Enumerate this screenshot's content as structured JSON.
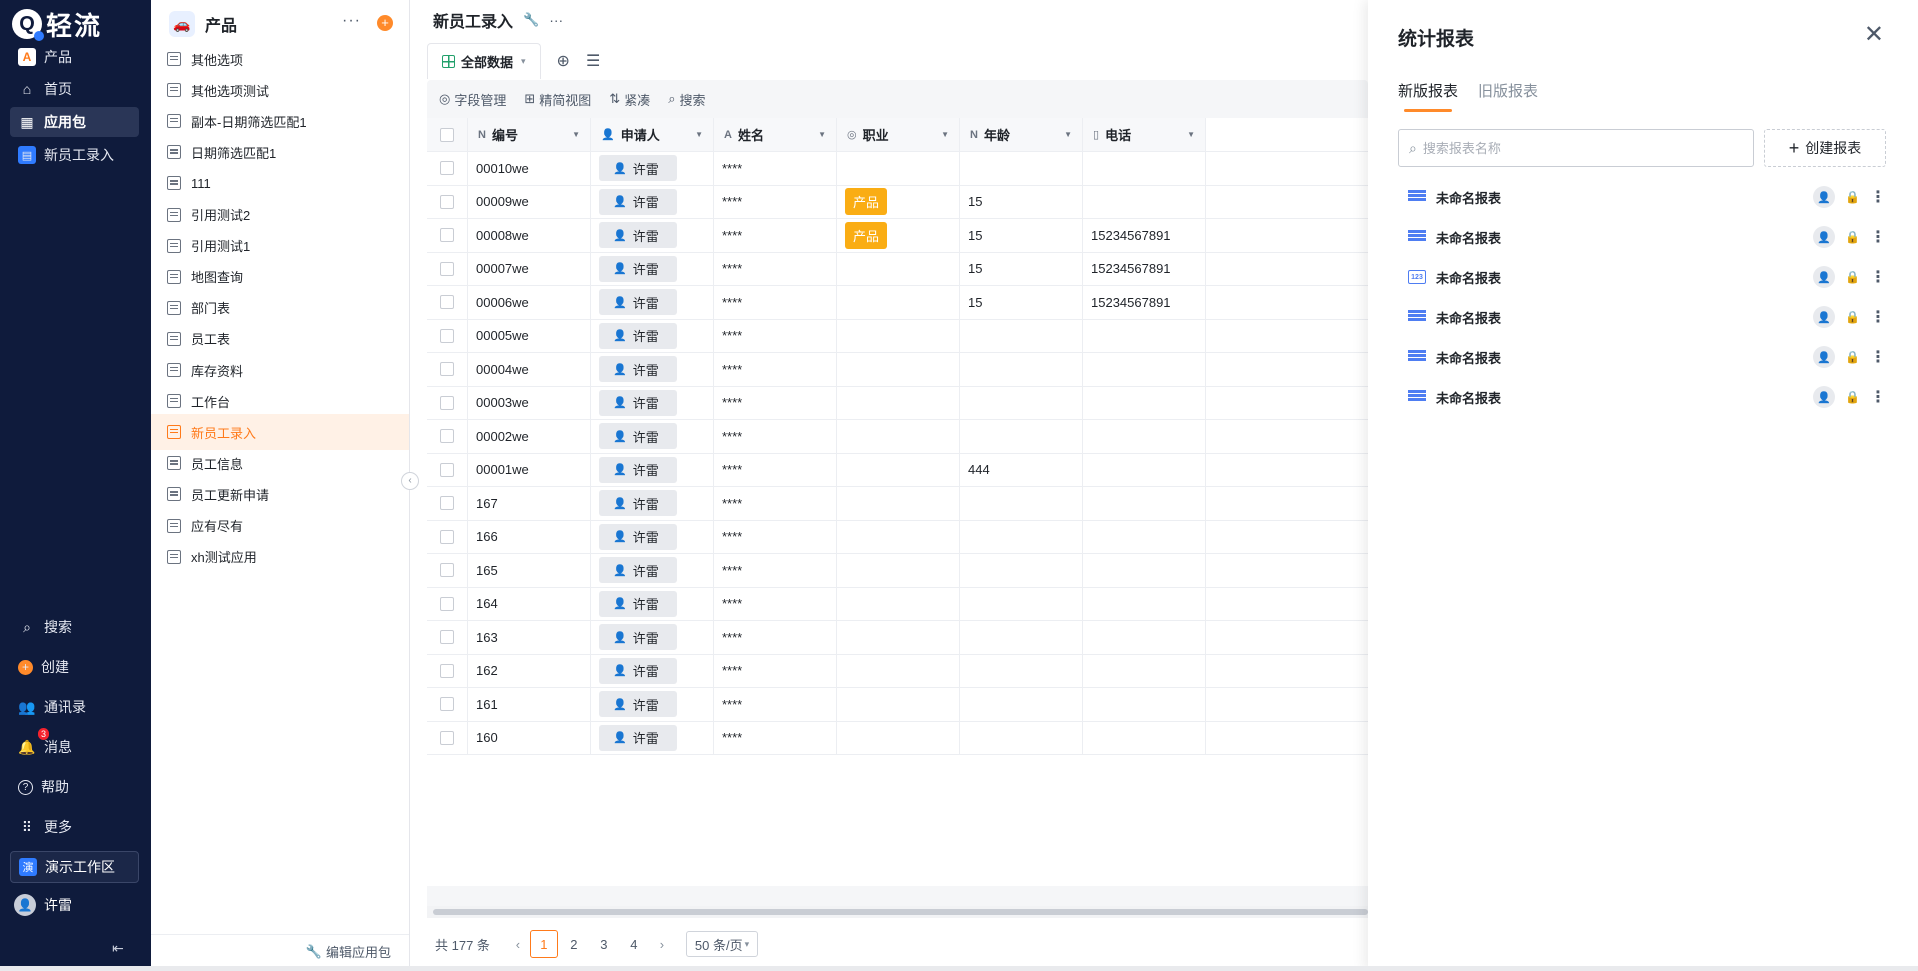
{
  "brand": {
    "name": "轻流",
    "q": "Q"
  },
  "sidebar": {
    "items": [
      {
        "label": "产品",
        "icon": "product-app-icon"
      },
      {
        "label": "首页",
        "icon": "home-icon"
      },
      {
        "label": "应用包",
        "icon": "apps-grid-icon",
        "active": true
      },
      {
        "label": "新员工录入",
        "icon": "form-app-icon"
      }
    ],
    "bottom": [
      {
        "label": "搜索",
        "icon": "search-icon"
      },
      {
        "label": "创建",
        "icon": "plus-circle-icon"
      },
      {
        "label": "通讯录",
        "icon": "contacts-icon"
      },
      {
        "label": "消息",
        "icon": "bell-icon",
        "badge": "3"
      },
      {
        "label": "帮助",
        "icon": "help-icon"
      },
      {
        "label": "更多",
        "icon": "more-grid-icon"
      }
    ],
    "workspace": {
      "label": "演示工作区",
      "glyph": "演"
    },
    "user": {
      "name": "许雷"
    }
  },
  "applist": {
    "title": "产品",
    "more": "···",
    "plus": "+",
    "items": [
      {
        "label": "其他选项"
      },
      {
        "label": "其他选项测试"
      },
      {
        "label": "副本-日期筛选匹配1"
      },
      {
        "label": "日期筛选匹配1"
      },
      {
        "label": "111",
        "dash": true
      },
      {
        "label": "引用测试2"
      },
      {
        "label": "引用测试1"
      },
      {
        "label": "地图查询"
      },
      {
        "label": "部门表"
      },
      {
        "label": "员工表"
      },
      {
        "label": "库存资料"
      },
      {
        "label": "工作台",
        "dash": true
      },
      {
        "label": "新员工录入",
        "active": true
      },
      {
        "label": "员工信息"
      },
      {
        "label": "员工更新申请"
      },
      {
        "label": "应有尽有"
      },
      {
        "label": "xh测试应用"
      }
    ],
    "footer": "编辑应用包"
  },
  "main": {
    "title": "新员工录入",
    "more": "···",
    "tab": "全部数据",
    "toolbar": [
      {
        "label": "字段管理",
        "icon": "field-manage-icon"
      },
      {
        "label": "精简视图",
        "icon": "simple-view-icon"
      },
      {
        "label": "紧凑",
        "icon": "compact-icon"
      },
      {
        "label": "搜索",
        "icon": "search-icon"
      }
    ],
    "columns": [
      {
        "label": "编号",
        "icon": "N"
      },
      {
        "label": "申请人",
        "icon": "👤"
      },
      {
        "label": "姓名",
        "icon": "A"
      },
      {
        "label": "职业",
        "icon": "◎"
      },
      {
        "label": "年龄",
        "icon": "N"
      },
      {
        "label": "电话",
        "icon": "▯"
      }
    ],
    "rows": [
      {
        "id": "00010we",
        "applicant": "许雷",
        "name": "****",
        "job": "",
        "age": "",
        "phone": ""
      },
      {
        "id": "00009we",
        "applicant": "许雷",
        "name": "****",
        "job": "产品",
        "age": "15",
        "phone": ""
      },
      {
        "id": "00008we",
        "applicant": "许雷",
        "name": "****",
        "job": "产品",
        "age": "15",
        "phone": "15234567891"
      },
      {
        "id": "00007we",
        "applicant": "许雷",
        "name": "****",
        "job": "",
        "age": "15",
        "phone": "15234567891"
      },
      {
        "id": "00006we",
        "applicant": "许雷",
        "name": "****",
        "job": "",
        "age": "15",
        "phone": "15234567891"
      },
      {
        "id": "00005we",
        "applicant": "许雷",
        "name": "****",
        "job": "",
        "age": "",
        "phone": ""
      },
      {
        "id": "00004we",
        "applicant": "许雷",
        "name": "****",
        "job": "",
        "age": "",
        "phone": ""
      },
      {
        "id": "00003we",
        "applicant": "许雷",
        "name": "****",
        "job": "",
        "age": "",
        "phone": ""
      },
      {
        "id": "00002we",
        "applicant": "许雷",
        "name": "****",
        "job": "",
        "age": "",
        "phone": ""
      },
      {
        "id": "00001we",
        "applicant": "许雷",
        "name": "****",
        "job": "",
        "age": "444",
        "phone": ""
      },
      {
        "id": "167",
        "applicant": "许雷",
        "name": "****",
        "job": "",
        "age": "",
        "phone": ""
      },
      {
        "id": "166",
        "applicant": "许雷",
        "name": "****",
        "job": "",
        "age": "",
        "phone": ""
      },
      {
        "id": "165",
        "applicant": "许雷",
        "name": "****",
        "job": "",
        "age": "",
        "phone": ""
      },
      {
        "id": "164",
        "applicant": "许雷",
        "name": "****",
        "job": "",
        "age": "",
        "phone": ""
      },
      {
        "id": "163",
        "applicant": "许雷",
        "name": "****",
        "job": "",
        "age": "",
        "phone": ""
      },
      {
        "id": "162",
        "applicant": "许雷",
        "name": "****",
        "job": "",
        "age": "",
        "phone": ""
      },
      {
        "id": "161",
        "applicant": "许雷",
        "name": "****",
        "job": "",
        "age": "",
        "phone": ""
      },
      {
        "id": "160",
        "applicant": "许雷",
        "name": "****",
        "job": "",
        "age": "",
        "phone": ""
      }
    ],
    "pager": {
      "total": "共 177 条",
      "pages": [
        "1",
        "2",
        "3",
        "4"
      ],
      "current": "1",
      "prev": "‹",
      "next": "›",
      "size": "50 条/页"
    }
  },
  "panel": {
    "title": "统计报表",
    "tabs": [
      {
        "label": "新版报表",
        "active": true
      },
      {
        "label": "旧版报表"
      }
    ],
    "search_placeholder": "搜索报表名称",
    "create_label": "创建报表",
    "reports": [
      {
        "name": "未命名报表",
        "type": "table"
      },
      {
        "name": "未命名报表",
        "type": "table"
      },
      {
        "name": "未命名报表",
        "type": "number"
      },
      {
        "name": "未命名报表",
        "type": "table"
      },
      {
        "name": "未命名报表",
        "type": "table"
      },
      {
        "name": "未命名报表",
        "type": "table"
      }
    ],
    "number_icon_text": "123"
  },
  "colors": {
    "accent": "#ff7a1a",
    "sidebar_bg": "#0f1b3c",
    "tag_yellow": "#faad14",
    "report_icon": "#4e7df2"
  }
}
